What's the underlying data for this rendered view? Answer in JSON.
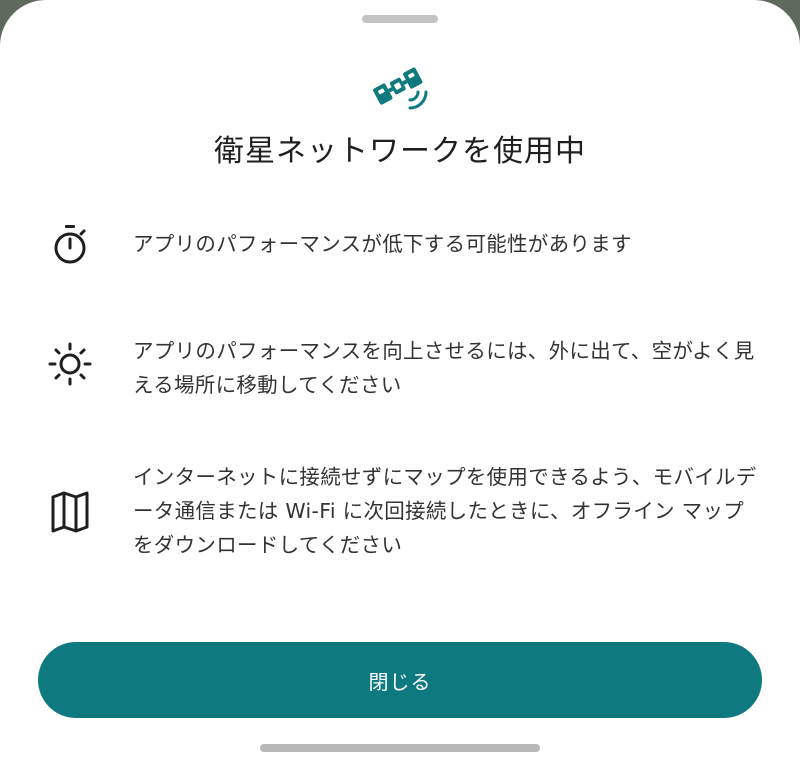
{
  "dialog": {
    "title": "衛星ネットワークを使用中",
    "header_icon": "satellite-icon",
    "accent_color": "#0e7a80",
    "items": [
      {
        "icon": "timer-icon",
        "text": "アプリのパフォーマンスが低下する可能性があります"
      },
      {
        "icon": "sun-icon",
        "text": "アプリのパフォーマンスを向上させるには、外に出て、空がよく見える場所に移動してください"
      },
      {
        "icon": "map-icon",
        "text": "インターネットに接続せずにマップを使用できるよう、モバイルデータ通信または Wi-Fi に次回接続したときに、オフライン マップをダウンロードしてください"
      }
    ],
    "close_label": "閉じる"
  }
}
